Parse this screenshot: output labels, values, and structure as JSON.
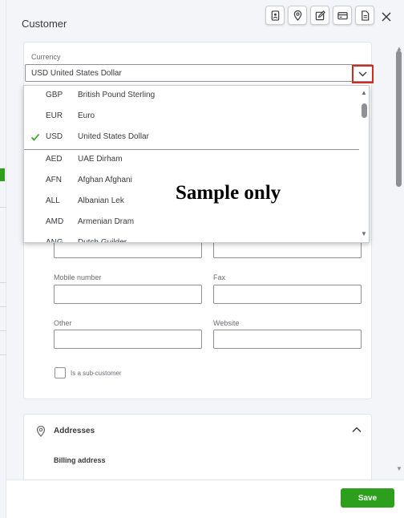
{
  "panel": {
    "title": "Customer",
    "toolbar_icons": [
      "contact-card-icon",
      "location-pin-icon",
      "edit-icon",
      "payment-card-icon",
      "document-icon"
    ],
    "close_icon": "close-icon"
  },
  "currency": {
    "label": "Currency",
    "value": "USD United States Dollar",
    "options": [
      {
        "code": "GBP",
        "name": "British Pound Sterling",
        "selected": false
      },
      {
        "code": "EUR",
        "name": "Euro",
        "selected": false
      },
      {
        "code": "USD",
        "name": "United States Dollar",
        "selected": true
      },
      {
        "code": "AED",
        "name": "UAE Dirham",
        "selected": false
      },
      {
        "code": "AFN",
        "name": "Afghan Afghani",
        "selected": false
      },
      {
        "code": "ALL",
        "name": "Albanian Lek",
        "selected": false
      },
      {
        "code": "AMD",
        "name": "Armenian Dram",
        "selected": false
      },
      {
        "code": "ANG",
        "name": "Dutch Guilder",
        "selected": false
      }
    ]
  },
  "fields": {
    "mobile_label": "Mobile number",
    "fax_label": "Fax",
    "other_label": "Other",
    "website_label": "Website",
    "subcustomer_label": "Is a sub-customer"
  },
  "addresses": {
    "title": "Addresses",
    "billing_label": "Billing address"
  },
  "footer": {
    "save_label": "Save"
  },
  "watermark": "Sample only",
  "colors": {
    "accent_green": "#2ca01c",
    "highlight_red": "#d52b1e",
    "check_green": "#2ca01c"
  }
}
